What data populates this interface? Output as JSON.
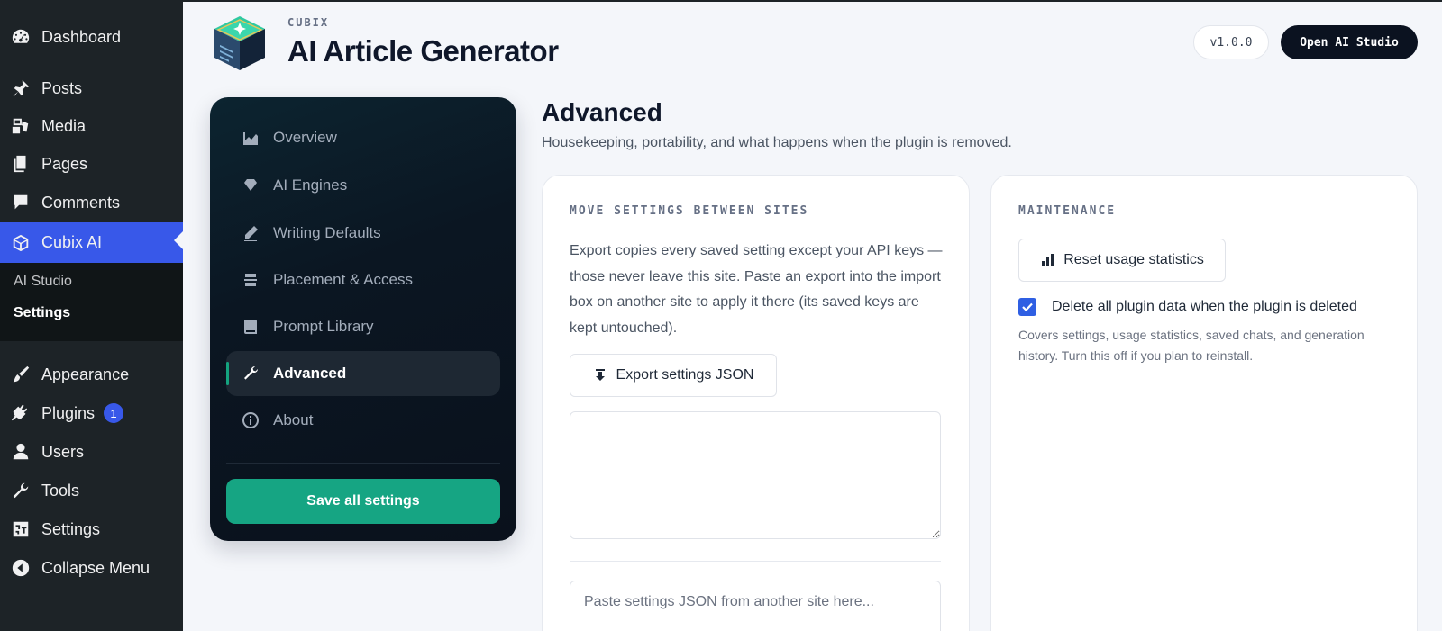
{
  "wp_menu": {
    "dashboard": "Dashboard",
    "posts": "Posts",
    "media": "Media",
    "pages": "Pages",
    "comments": "Comments",
    "cubix_ai": "Cubix AI",
    "submenu": {
      "ai_studio": "AI Studio",
      "settings": "Settings"
    },
    "appearance": "Appearance",
    "plugins": "Plugins",
    "plugins_badge": "1",
    "users": "Users",
    "tools": "Tools",
    "settings": "Settings",
    "collapse": "Collapse Menu"
  },
  "header": {
    "brand": "CUBIX",
    "title": "AI Article Generator",
    "version": "v1.0.0",
    "open_studio": "Open AI Studio"
  },
  "plugin_nav": {
    "items": [
      {
        "label": "Overview",
        "icon": "chart-icon"
      },
      {
        "label": "AI Engines",
        "icon": "gem-icon"
      },
      {
        "label": "Writing Defaults",
        "icon": "pencil-icon"
      },
      {
        "label": "Placement & Access",
        "icon": "layers-icon"
      },
      {
        "label": "Prompt Library",
        "icon": "book-icon"
      },
      {
        "label": "Advanced",
        "icon": "wrench-icon",
        "active": true
      },
      {
        "label": "About",
        "icon": "info-icon"
      }
    ],
    "save": "Save all settings"
  },
  "main": {
    "title": "Advanced",
    "subtitle": "Housekeeping, portability, and what happens when the plugin is removed.",
    "move_card": {
      "heading": "MOVE SETTINGS BETWEEN SITES",
      "description": "Export copies every saved setting except your API keys — those never leave this site. Paste an export into the import box on another site to apply it there (its saved keys are kept untouched).",
      "export_button": "Export settings JSON",
      "export_value": "",
      "import_placeholder": "Paste settings JSON from another site here..."
    },
    "maintenance_card": {
      "heading": "MAINTENANCE",
      "reset_button": "Reset usage statistics",
      "delete_label": "Delete all plugin data when the plugin is deleted",
      "delete_checked": true,
      "delete_help": "Covers settings, usage statistics, saved chats, and generation history. Turn this off if you plan to reinstall."
    }
  },
  "colors": {
    "wp_sidebar": "#1d2327",
    "wp_active": "#3858e9",
    "accent_green": "#16a583",
    "nav_dark": "#0b1622",
    "checkbox": "#2f5fe3"
  }
}
